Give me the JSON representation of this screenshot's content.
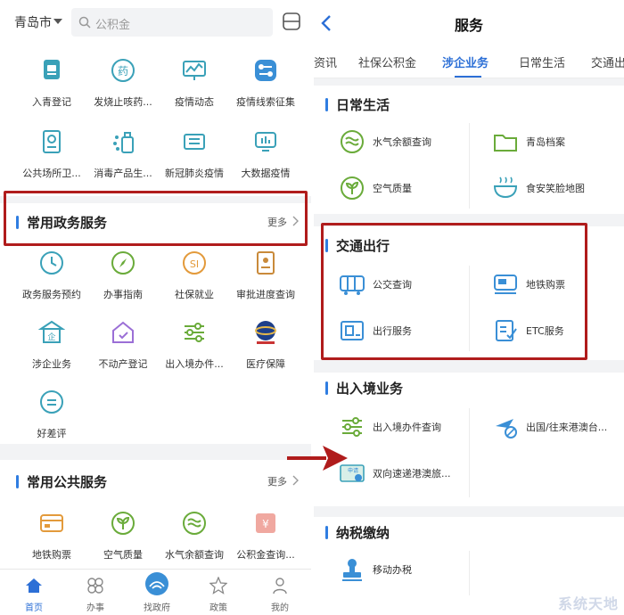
{
  "left": {
    "city": "青岛市",
    "search_placeholder": "公积金",
    "grid1": [
      {
        "label": "入青登记",
        "icon": "register-card-icon"
      },
      {
        "label": "发烧止咳药...",
        "icon": "medicine-icon"
      },
      {
        "label": "疫情动态",
        "icon": "chart-monitor-icon"
      },
      {
        "label": "疫情线索征集",
        "icon": "clue-collect-icon"
      },
      {
        "label": "公共场所卫...",
        "icon": "venue-certificate-icon"
      },
      {
        "label": "消毒产品生...",
        "icon": "disinfect-product-icon"
      },
      {
        "label": "新冠肺炎疫情",
        "icon": "ticket-icon"
      },
      {
        "label": "大数据疫情",
        "icon": "bigdata-screen-icon"
      }
    ],
    "section_gov": {
      "title": "常用政务服务",
      "more": "更多"
    },
    "grid2": [
      {
        "label": "政务服务预约",
        "icon": "clock-icon"
      },
      {
        "label": "办事指南",
        "icon": "compass-icon"
      },
      {
        "label": "社保就业",
        "icon": "social-security-icon"
      },
      {
        "label": "审批进度查询",
        "icon": "approval-progress-icon"
      },
      {
        "label": "涉企业务",
        "icon": "enterprise-icon"
      },
      {
        "label": "不动产登记",
        "icon": "house-icon"
      },
      {
        "label": "出入境办件...",
        "icon": "sliders-icon"
      },
      {
        "label": "医疗保障",
        "icon": "medical-insurance-logo-icon"
      },
      {
        "label": "好差评",
        "icon": "comment-icon"
      }
    ],
    "section_public": {
      "title": "常用公共服务",
      "more": "更多"
    },
    "grid3": [
      {
        "label": "地铁购票",
        "icon": "metro-ticket-icon"
      },
      {
        "label": "空气质量",
        "icon": "sprout-icon"
      },
      {
        "label": "水气余额查询",
        "icon": "water-gas-icon"
      },
      {
        "label": "公积金查询...",
        "icon": "fund-icon"
      }
    ],
    "tabs": [
      {
        "label": "首页",
        "icon": "home-icon",
        "active": true
      },
      {
        "label": "办事",
        "icon": "clover-icon",
        "active": false
      },
      {
        "label": "找政府",
        "icon": "government-icon",
        "active": false
      },
      {
        "label": "政策",
        "icon": "star-icon",
        "active": false
      },
      {
        "label": "我的",
        "icon": "person-icon",
        "active": false
      }
    ]
  },
  "right": {
    "title": "服务",
    "tabs": [
      "资讯",
      "社保公积金",
      "涉企业务",
      "日常生活",
      "交通出"
    ],
    "active_tab": "涉企业务",
    "daily": {
      "title": "日常生活",
      "items": [
        {
          "label": "水气余额查询",
          "icon": "water-gas-icon"
        },
        {
          "label": "青岛档案",
          "icon": "folder-icon"
        },
        {
          "label": "空气质量",
          "icon": "sprout-icon"
        },
        {
          "label": "食安笑脸地图",
          "icon": "food-bowl-icon"
        }
      ]
    },
    "traffic": {
      "title": "交通出行",
      "items": [
        {
          "label": "公交查询",
          "icon": "bus-icon"
        },
        {
          "label": "地铁购票",
          "icon": "metro-ticket-icon"
        },
        {
          "label": "出行服务",
          "icon": "travel-service-icon"
        },
        {
          "label": "ETC服务",
          "icon": "etc-icon"
        }
      ]
    },
    "border": {
      "title": "出入境业务",
      "items": [
        {
          "label": "出入境办件查询",
          "icon": "sliders-icon"
        },
        {
          "label": "出国/往来港澳台...",
          "icon": "plane-globe-icon"
        },
        {
          "label": "双向速递港澳旅...",
          "icon": "permit-card-icon"
        }
      ]
    },
    "tax": {
      "title": "纳税缴纳",
      "items": [
        {
          "label": "移动办税",
          "icon": "stamp-icon"
        }
      ]
    },
    "watermark": "系统天地"
  },
  "colors": {
    "accent": "#2c6fd6",
    "icon_teal": "#3aa1b8",
    "icon_green": "#6aab3a",
    "highlight_red": "#b01c1c"
  }
}
